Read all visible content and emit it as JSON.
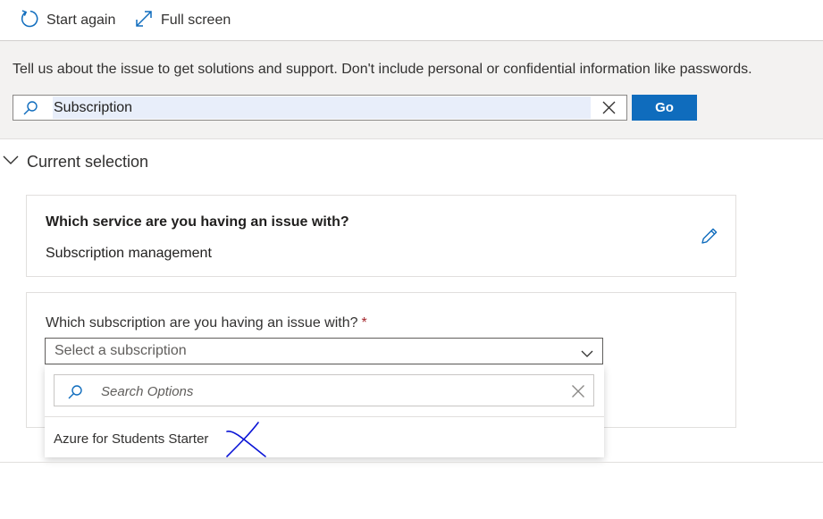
{
  "toolbar": {
    "start_again_label": "Start again",
    "start_again_icon": "refresh-icon",
    "full_screen_label": "Full screen",
    "full_screen_icon": "expand-icon"
  },
  "search": {
    "intro": "Tell us about the issue to get solutions and support. Don't include personal or confidential information like passwords.",
    "value": "Subscription",
    "go_label": "Go"
  },
  "current_selection": {
    "title": "Current selection",
    "service_question": "Which service are you having an issue with?",
    "service_answer": "Subscription management",
    "subscription_question": "Which subscription are you having an issue with?",
    "required_marker": "*",
    "subscription_placeholder": "Select a subscription"
  },
  "subscription_dropdown": {
    "search_placeholder": "Search Options",
    "options": [
      "Azure for Students Starter"
    ]
  },
  "colors": {
    "accent": "#0f6cbd",
    "search_band": "#f3f2f1",
    "selection_highlight": "#e8eefa",
    "required": "#a4262c",
    "handwritten_mark": "#0a14d6"
  }
}
